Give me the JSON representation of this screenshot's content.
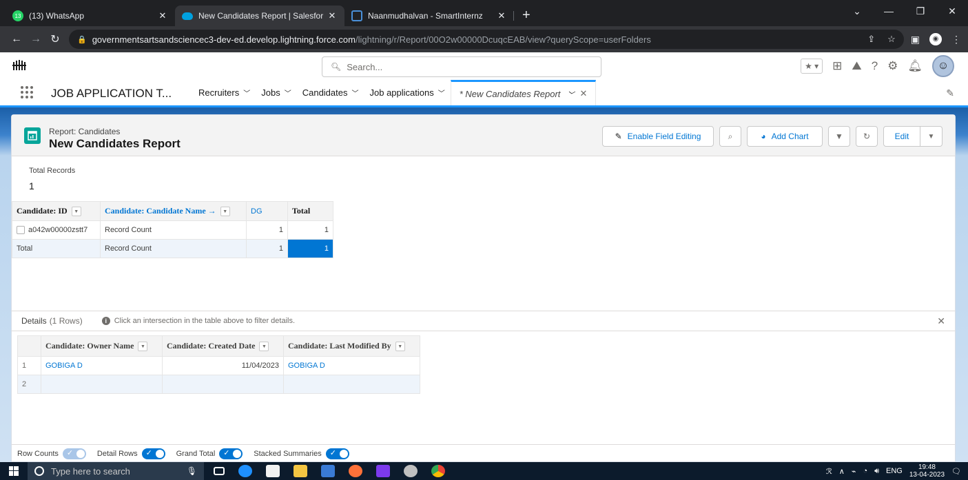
{
  "browser": {
    "tabs": [
      {
        "title": "(13) WhatsApp",
        "active": false,
        "favicon_color": "#25d366",
        "badge": "13"
      },
      {
        "title": "New Candidates Report | Salesfor",
        "active": true,
        "favicon_color": "#00a1e0"
      },
      {
        "title": "Naanmudhalvan - SmartInternz",
        "active": false,
        "favicon_color": "#4a90d9"
      }
    ],
    "new_tab_glyph": "+",
    "url_host": "governmentsartsandsciencec3-dev-ed.develop.lightning.force.com",
    "url_path": "/lightning/r/Report/00O2w00000DcuqcEAB/view?queryScope=userFolders"
  },
  "sf": {
    "search_placeholder": "Search...",
    "app_name": "JOB APPLICATION T...",
    "nav": [
      {
        "label": "Recruiters"
      },
      {
        "label": "Jobs"
      },
      {
        "label": "Candidates"
      },
      {
        "label": "Job applications"
      }
    ],
    "active_tab": "* New Candidates Report"
  },
  "report": {
    "type_label": "Report: Candidates",
    "title": "New Candidates Report",
    "buttons": {
      "enable_field_editing": "Enable Field Editing",
      "add_chart": "Add Chart",
      "edit": "Edit"
    },
    "total_records_label": "Total Records",
    "total_records_value": "1",
    "summary": {
      "headers": {
        "id": "Candidate: ID",
        "name": "Candidate: Candidate Name →",
        "dg": "DG",
        "total": "Total"
      },
      "row": {
        "id": "a042w00000zstt7",
        "name": "Record Count",
        "dg": "1",
        "total": "1"
      },
      "total_row": {
        "label": "Total",
        "name": "Record Count",
        "dg": "1",
        "total": "1"
      }
    },
    "details": {
      "title": "Details",
      "count": "(1 Rows)",
      "hint": "Click an intersection in the table above to filter details.",
      "headers": {
        "owner": "Candidate: Owner Name",
        "created": "Candidate: Created Date",
        "modified": "Candidate: Last Modified By"
      },
      "rows": [
        {
          "n": "1",
          "owner": "GOBIGA D",
          "created": "11/04/2023",
          "modified": "GOBIGA D"
        },
        {
          "n": "2",
          "owner": "",
          "created": "",
          "modified": ""
        }
      ]
    },
    "footer": {
      "row_counts": "Row Counts",
      "detail_rows": "Detail Rows",
      "grand_total": "Grand Total",
      "stacked_summaries": "Stacked Summaries"
    }
  },
  "taskbar": {
    "search_placeholder": "Type here to search",
    "lang": "ENG",
    "time": "19:48",
    "date": "13-04-2023"
  }
}
